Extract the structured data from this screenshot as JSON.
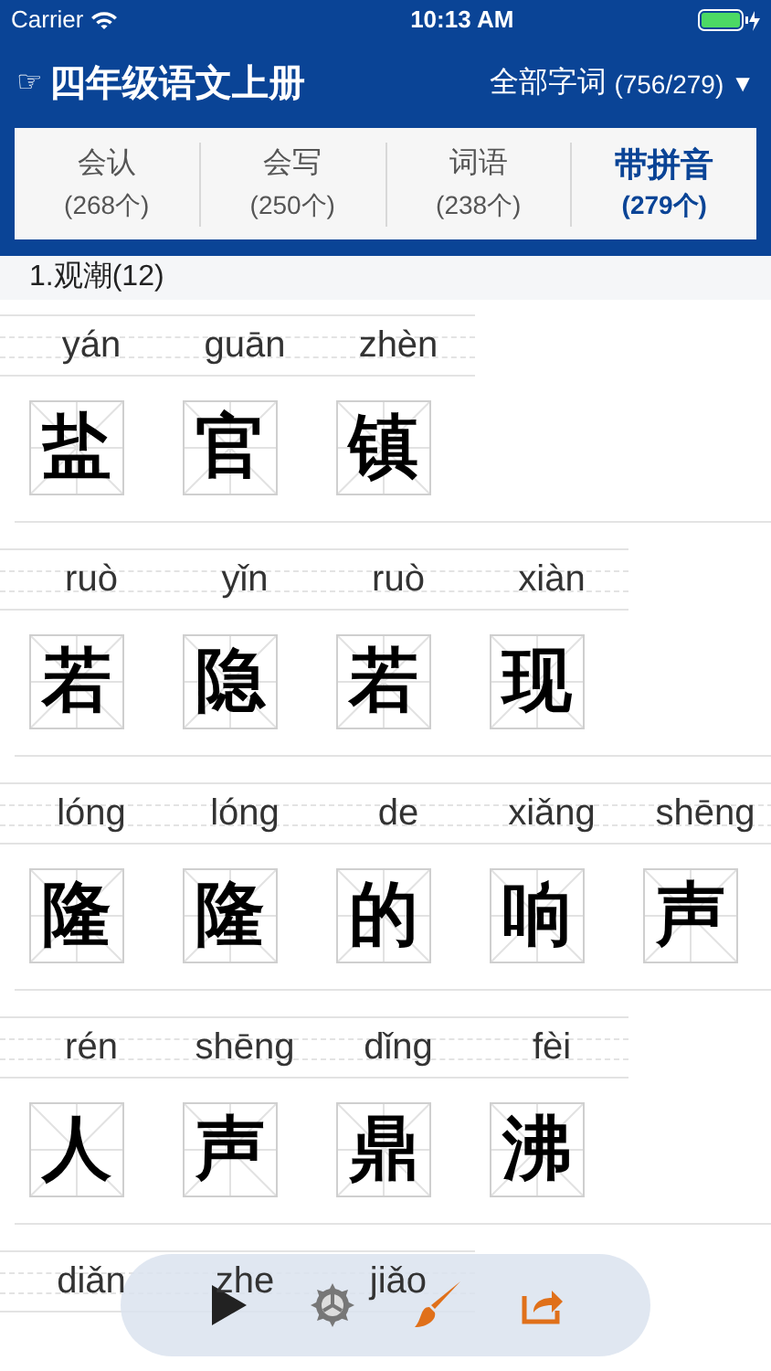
{
  "status_bar": {
    "carrier": "Carrier",
    "time": "10:13 AM"
  },
  "header": {
    "pointer": "☞",
    "title": "四年级语文上册",
    "filter": "全部字词",
    "filter_count": "(756/279)",
    "dropdown": "▼"
  },
  "tabs": [
    {
      "label": "会认",
      "count": "(268个)",
      "selected": false
    },
    {
      "label": "会写",
      "count": "(250个)",
      "selected": false
    },
    {
      "label": "词语",
      "count": "(238个)",
      "selected": false
    },
    {
      "label": "带拼音",
      "count": "(279个)",
      "selected": true
    }
  ],
  "lesson": {
    "title": "1.观潮(12)"
  },
  "rows": [
    [
      {
        "pinyin": "yán",
        "char": "盐"
      },
      {
        "pinyin": "guān",
        "char": "官"
      },
      {
        "pinyin": "zhèn",
        "char": "镇"
      }
    ],
    [
      {
        "pinyin": "ruò",
        "char": "若"
      },
      {
        "pinyin": "yǐn",
        "char": "隐"
      },
      {
        "pinyin": "ruò",
        "char": "若"
      },
      {
        "pinyin": "xiàn",
        "char": "现"
      }
    ],
    [
      {
        "pinyin": "lóng",
        "char": "隆"
      },
      {
        "pinyin": "lóng",
        "char": "隆"
      },
      {
        "pinyin": "de",
        "char": "的"
      },
      {
        "pinyin": "xiǎng",
        "char": "响"
      },
      {
        "pinyin": "shēng",
        "char": "声"
      }
    ],
    [
      {
        "pinyin": "rén",
        "char": "人"
      },
      {
        "pinyin": "shēng",
        "char": "声"
      },
      {
        "pinyin": "dǐng",
        "char": "鼎"
      },
      {
        "pinyin": "fèi",
        "char": "沸"
      }
    ],
    [
      {
        "pinyin": "diǎn"
      },
      {
        "pinyin": "zhe"
      },
      {
        "pinyin": "jiǎo"
      }
    ]
  ],
  "toolbar": [
    {
      "kind": "play"
    },
    {
      "kind": "settings"
    },
    {
      "kind": "brush"
    },
    {
      "kind": "share"
    }
  ]
}
